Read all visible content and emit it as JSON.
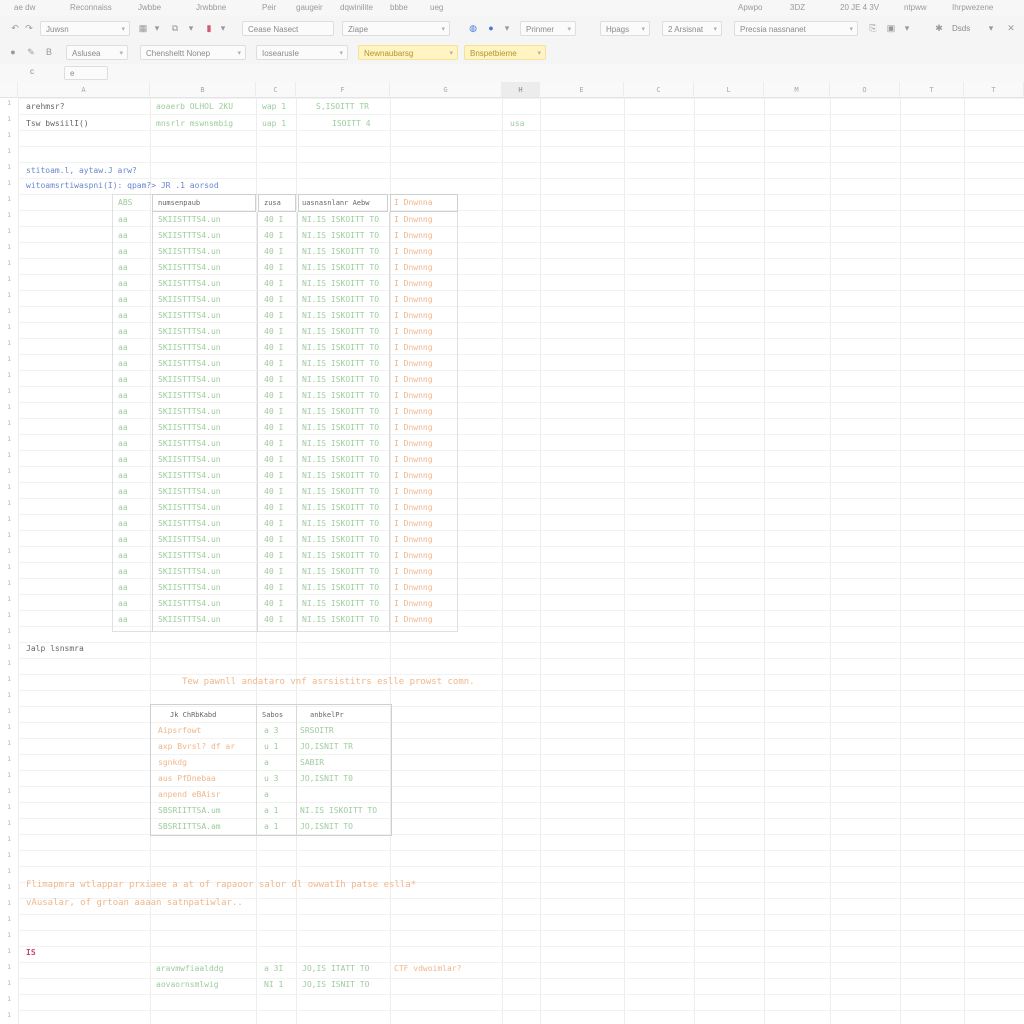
{
  "menu": [
    "ae dw",
    "Reconnaiss",
    "Jwbbe",
    "Jrwbbne",
    "Peir",
    "gaugeir",
    "dqwinilite",
    "bbbe",
    "ueg"
  ],
  "menu_right": [
    "Apwpo",
    "3DZ",
    "20 JE 4 3V",
    "ntpww",
    "Ihrpwezene"
  ],
  "toolbar1": {
    "search_value": "Juwsn",
    "font_name": "Cease Nasect",
    "font_size": "Ziape",
    "format": "Prinmer",
    "label1": "Hpags",
    "label2": "2 Arsisnat",
    "label3": "Precsia nassnanet",
    "right_label": "Dsds"
  },
  "toolbar2": {
    "field1": "Aslusea",
    "field2": "Chensheltt Nonep",
    "field3": "Iosearusle",
    "style1": "Newnaubarsg",
    "style2": "Bnspetbieme"
  },
  "formula_bar": {
    "cell_ref": "c",
    "value": "e"
  },
  "columns": [
    "A",
    "B",
    "C",
    "F",
    "G",
    "H",
    "E",
    "C",
    "L",
    "M",
    "O",
    "T",
    "T",
    "T"
  ],
  "selected_column_index": 5,
  "top": {
    "r1": [
      "arehmsr?",
      "aoaerb OLHOL 2KU",
      "wap 1",
      "S,ISOITT TR"
    ],
    "r2": [
      "Tsw bwsiilI()",
      "mnsrlr mswnsmbig",
      "uap 1",
      "ISOITT 4",
      "usa"
    ]
  },
  "code": {
    "line1": "stitoam.l, aytaw.J arw?",
    "line2": "witoamsrtiwaspni(I):  qpam?> JR .1  aorsod"
  },
  "table": {
    "headers": [
      "ABS",
      "numsenpaub",
      "zusa",
      "uasnasnlanr Aebw",
      "I Dnwnna"
    ],
    "row": [
      "aa",
      "SKIISTTTS4.un",
      "40 I",
      "NI.IS ISKOITT TO",
      "I Dnwnng"
    ],
    "row_count": 26
  },
  "section_label": "Jalp lsnsmra",
  "note1": "Tew pawnll andataro vnf asrsistitrs eslle prowst comn.",
  "small_table": {
    "headers": [
      "Jk ChRbKabd",
      "Sabos",
      "anbkelPr"
    ],
    "rows": [
      [
        "Aipsrfowt",
        "a 3",
        "SRSOITR"
      ],
      [
        "axp Bvrsl? df ar",
        "u 1",
        "JO,ISNIT TR"
      ],
      [
        "sgnkdg",
        "a",
        "SABIR"
      ],
      [
        "aus PfDnebaa",
        "u 3",
        "JO,ISNIT T0"
      ],
      [
        "anpend eBAisr",
        "a",
        ""
      ],
      [
        "SBSRIITTSA.um",
        "a 1",
        "NI.IS ISKOITT TO"
      ],
      [
        "SBSRIITTSA.am",
        "a 1",
        "JO,ISNIT TO"
      ]
    ]
  },
  "note2": {
    "line1": "Flimapmra wtlappar prxiaee a at of rapaoor salor dl owwatIh patse eslla*",
    "line2": "vAusalar, of grtoan aaaan satnpatiwlar.."
  },
  "marker": "IS",
  "bottom": {
    "r1": [
      "aravmwfiaalddg",
      "a 3I",
      "JO,IS ITATT TO",
      "CTF vdwoimlar?"
    ],
    "r2": [
      "aovaornsmlwig",
      "NI 1",
      "JO,IS ISNIT TO"
    ]
  },
  "colors": {
    "green_text": "#9ccc9c",
    "orange_text": "#f0b68a",
    "blue_text": "#6a86cf",
    "highlight": "#fff4c2"
  }
}
